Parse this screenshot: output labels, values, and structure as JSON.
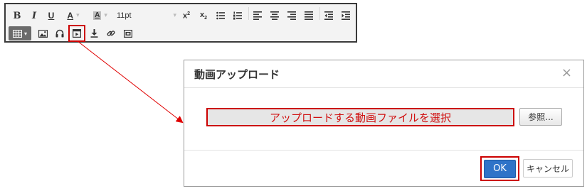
{
  "toolbar": {
    "row1": {
      "bold": "B",
      "italic": "I",
      "underline": "U",
      "font_color": "A",
      "highlight": "A",
      "font_size": "11pt",
      "superscript_base": "x",
      "superscript_mark": "2",
      "subscript_base": "x",
      "subscript_mark": "2"
    },
    "icons": [
      "bold-icon",
      "italic-icon",
      "underline-icon",
      "font-color-icon",
      "highlight-icon",
      "font-size-select",
      "superscript-icon",
      "subscript-icon",
      "bullet-list-icon",
      "numbered-list-icon",
      "align-left-icon",
      "align-center-icon",
      "align-right-icon",
      "align-justify-icon",
      "outdent-icon",
      "indent-icon",
      "table-icon",
      "image-icon",
      "audio-icon",
      "video-icon",
      "download-icon",
      "link-icon",
      "embed-icon"
    ],
    "caret": "▾"
  },
  "dialog": {
    "title": "動画アップロード",
    "close": "×",
    "file_field": "アップロードする動画ファイルを選択",
    "browse_button": "参照...",
    "ok_button": "OK",
    "cancel_button": "キャンセル"
  },
  "colors": {
    "highlight_red": "#cc0000",
    "ok_blue": "#2f73c8",
    "toolbar_bg": "#f3f3f3",
    "field_bg": "#e6e6e6"
  }
}
